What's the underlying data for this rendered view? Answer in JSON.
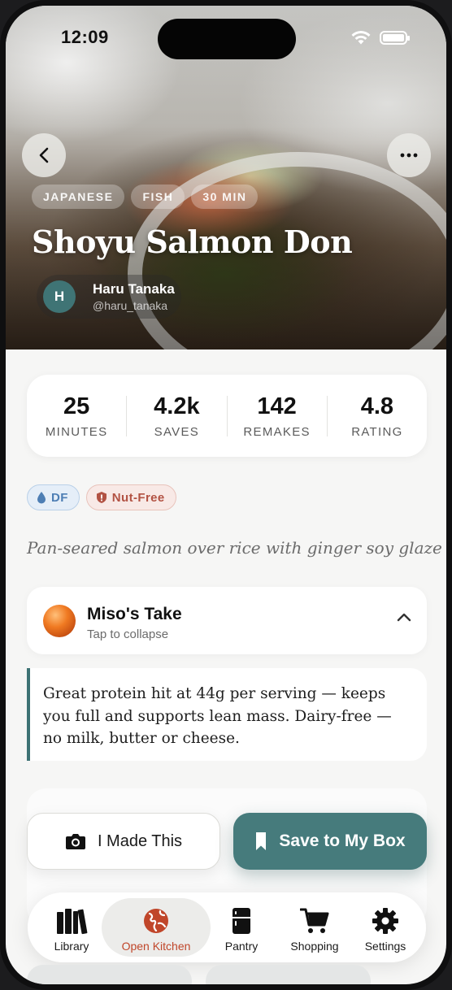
{
  "status_bar": {
    "time": "12:09"
  },
  "hero": {
    "tags": [
      "JAPANESE",
      "FISH",
      "30 MIN"
    ],
    "title": "Shoyu Salmon Don",
    "author": {
      "initial": "H",
      "name": "Haru Tanaka",
      "handle": "@haru_tanaka"
    }
  },
  "stats": [
    {
      "value": "25",
      "label": "MINUTES"
    },
    {
      "value": "4.2k",
      "label": "SAVES"
    },
    {
      "value": "142",
      "label": "REMAKES"
    },
    {
      "value": "4.8",
      "label": "RATING"
    }
  ],
  "badges": [
    {
      "label": "DF",
      "icon": "water-drop-icon",
      "color": "#4d7eb4"
    },
    {
      "label": "Nut-Free",
      "icon": "shield-alert-icon",
      "color": "#b25243"
    }
  ],
  "description": "Pan-seared salmon over rice with ginger soy glaze",
  "miso": {
    "title": "Miso's Take",
    "subtitle": "Tap to collapse",
    "take": "Great protein hit at 44g per serving — keeps you full and supports lean mass. Dairy-free — no milk, butter or cheese."
  },
  "actions": {
    "made_label": "I Made This",
    "save_label": "Save to My Box"
  },
  "tabs": [
    {
      "label": "Library",
      "icon": "books-icon"
    },
    {
      "label": "Open Kitchen",
      "icon": "globe-icon",
      "active": true
    },
    {
      "label": "Pantry",
      "icon": "fridge-icon"
    },
    {
      "label": "Shopping",
      "icon": "cart-icon"
    },
    {
      "label": "Settings",
      "icon": "gear-icon"
    }
  ],
  "colors": {
    "accent": "#467b7c",
    "active_tab": "#c0462a"
  }
}
